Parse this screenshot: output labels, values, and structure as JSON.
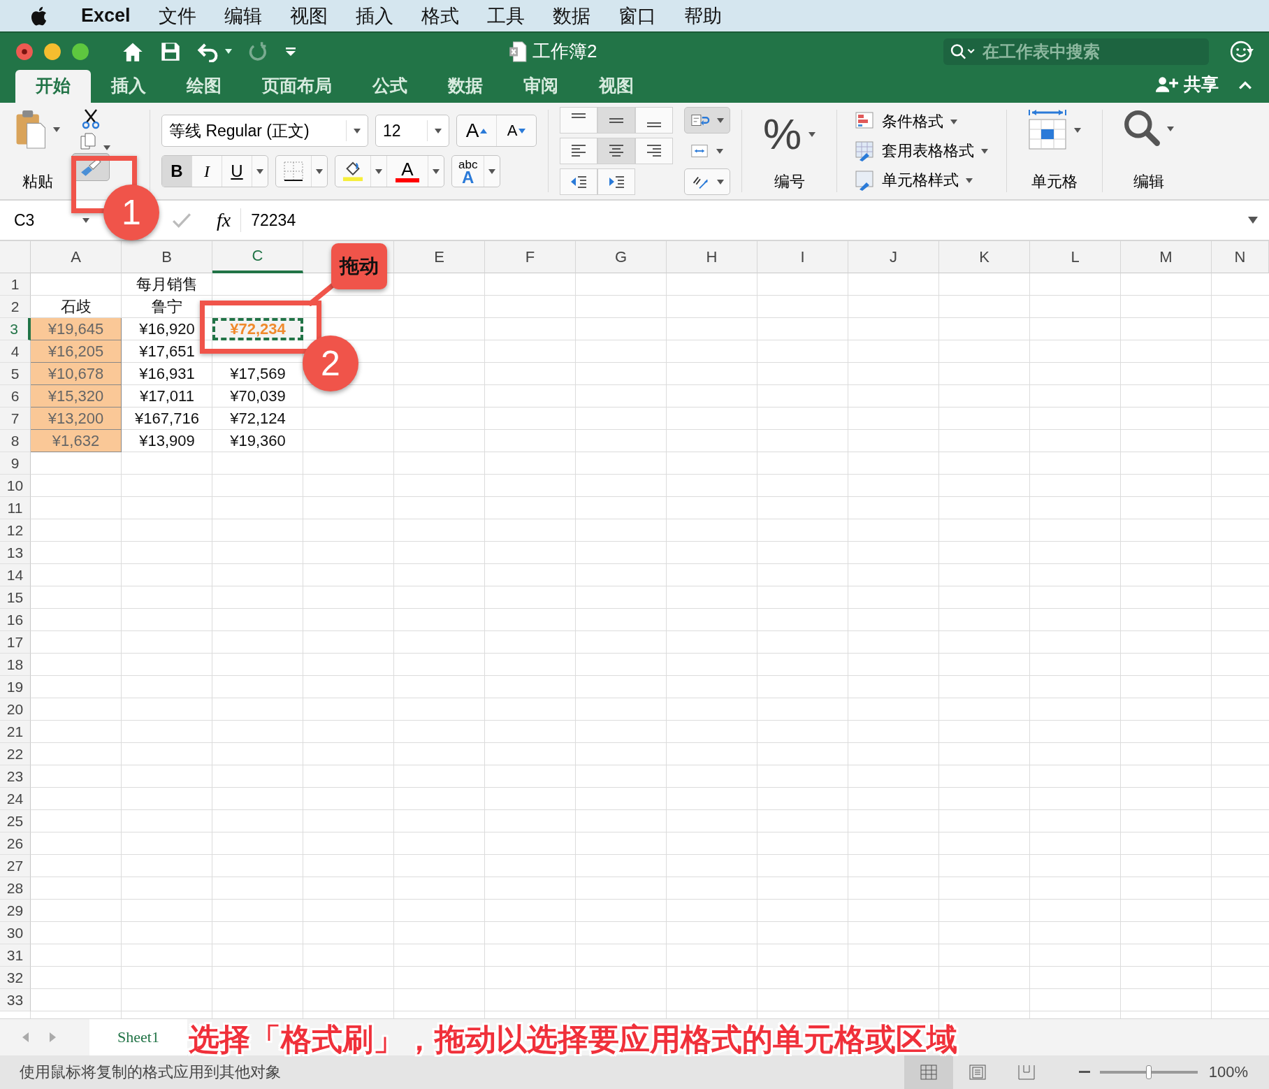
{
  "menu_bar": {
    "app": "Excel",
    "items": [
      "文件",
      "编辑",
      "视图",
      "插入",
      "格式",
      "工具",
      "数据",
      "窗口",
      "帮助"
    ]
  },
  "window": {
    "title": "工作簿2",
    "search": {
      "placeholder": "在工作表中搜索"
    },
    "redo_disabled": true
  },
  "tabs": [
    {
      "label": "开始",
      "selected": true
    },
    {
      "label": "插入",
      "selected": false
    },
    {
      "label": "绘图",
      "selected": false
    },
    {
      "label": "页面布局",
      "selected": false
    },
    {
      "label": "公式",
      "selected": false
    },
    {
      "label": "数据",
      "selected": false
    },
    {
      "label": "审阅",
      "selected": false
    },
    {
      "label": "视图",
      "selected": false
    }
  ],
  "share": "共享",
  "ribbon": {
    "paste": "粘贴",
    "font_name": "等线 Regular (正文)",
    "font_size": "12",
    "grow": "A",
    "shrink": "A",
    "bold": "B",
    "italic": "I",
    "underline": "U",
    "font_color": "A",
    "abc": "abc",
    "abc_letter": "A",
    "number_symbol": "%",
    "number": "编号",
    "styles": [
      "条件格式",
      "套用表格格式",
      "单元格样式"
    ],
    "cells": "单元格",
    "editing": "编辑"
  },
  "formula_bar": {
    "name_box": "C3",
    "fx": "fx",
    "formula": "72234"
  },
  "sheet": {
    "columns": [
      {
        "label": "A",
        "selected": false
      },
      {
        "label": "B",
        "selected": false
      },
      {
        "label": "C",
        "selected": true
      },
      {
        "selected": false
      },
      {
        "label": "E",
        "selected": false
      },
      {
        "label": "F",
        "selected": false
      },
      {
        "label": "G",
        "selected": false
      },
      {
        "label": "H",
        "selected": false
      },
      {
        "label": "I",
        "selected": false
      },
      {
        "label": "J",
        "selected": false
      },
      {
        "label": "K",
        "selected": false
      },
      {
        "label": "L",
        "selected": false
      },
      {
        "label": "M",
        "selected": false
      },
      {
        "label": "N",
        "selected": false
      }
    ],
    "rows": [
      {
        "header": "1",
        "selected": false,
        "cells": [
          null,
          {
            "text": "每月销售",
            "selected": false,
            "highlighted": false
          },
          null
        ]
      },
      {
        "header": "2",
        "selected": false,
        "cells": [
          {
            "text": "石歧",
            "selected": false,
            "highlighted": false
          },
          {
            "text": "鲁宁",
            "selected": false,
            "highlighted": false
          },
          null
        ]
      },
      {
        "header": "3",
        "selected": true,
        "cells": [
          {
            "text": "¥19,645",
            "selected": false,
            "highlighted": true
          },
          {
            "text": "¥16,920",
            "selected": false,
            "highlighted": false
          },
          {
            "text": "¥72,234",
            "selected": true,
            "highlighted": false
          }
        ]
      },
      {
        "header": "4",
        "selected": false,
        "cells": [
          {
            "text": "¥16,205",
            "selected": false,
            "highlighted": true
          },
          {
            "text": "¥17,651",
            "selected": false,
            "highlighted": false
          },
          null
        ]
      },
      {
        "header": "5",
        "selected": false,
        "cells": [
          {
            "text": "¥10,678",
            "selected": false,
            "highlighted": true
          },
          {
            "text": "¥16,931",
            "selected": false,
            "highlighted": false
          },
          {
            "text": "¥17,569",
            "selected": false,
            "highlighted": false
          }
        ]
      },
      {
        "header": "6",
        "selected": false,
        "cells": [
          {
            "text": "¥15,320",
            "selected": false,
            "highlighted": true
          },
          {
            "text": "¥17,011",
            "selected": false,
            "highlighted": false
          },
          {
            "text": "¥70,039",
            "selected": false,
            "highlighted": false
          }
        ]
      },
      {
        "header": "7",
        "selected": false,
        "cells": [
          {
            "text": "¥13,200",
            "selected": false,
            "highlighted": true
          },
          {
            "text": "¥167,716",
            "selected": false,
            "highlighted": false
          },
          {
            "text": "¥72,124",
            "selected": false,
            "highlighted": false
          }
        ]
      },
      {
        "header": "8",
        "selected": false,
        "cells": [
          {
            "text": "¥1,632",
            "selected": false,
            "highlighted": true
          },
          {
            "text": "¥13,909",
            "selected": false,
            "highlighted": false
          },
          {
            "text": "¥19,360",
            "selected": false,
            "highlighted": false
          }
        ]
      },
      {
        "header": "9",
        "selected": false
      },
      {
        "header": "10",
        "selected": false
      },
      {
        "header": "11",
        "selected": false
      },
      {
        "header": "12",
        "selected": false
      },
      {
        "header": "13",
        "selected": false
      },
      {
        "header": "14",
        "selected": false
      },
      {
        "header": "15",
        "selected": false
      },
      {
        "header": "16",
        "selected": false
      },
      {
        "header": "17",
        "selected": false
      },
      {
        "header": "18",
        "selected": false
      },
      {
        "header": "19",
        "selected": false
      },
      {
        "header": "20",
        "selected": false
      },
      {
        "header": "21",
        "selected": false
      },
      {
        "header": "22",
        "selected": false
      },
      {
        "header": "23",
        "selected": false
      },
      {
        "header": "24",
        "selected": false
      },
      {
        "header": "25",
        "selected": false
      },
      {
        "header": "26",
        "selected": false
      },
      {
        "header": "27",
        "selected": false
      },
      {
        "header": "28",
        "selected": false
      },
      {
        "header": "29",
        "selected": false
      },
      {
        "header": "30",
        "selected": false
      },
      {
        "header": "31",
        "selected": false
      },
      {
        "header": "32",
        "selected": false
      },
      {
        "header": "33",
        "selected": false
      }
    ]
  },
  "sheet_tabs": [
    {
      "label": "Sheet1",
      "selected": true
    }
  ],
  "status_bar": {
    "message": "使用鼠标将复制的格式应用到其他对象",
    "zoom": "100%",
    "zoom_slider": {
      "level": 0.5
    }
  },
  "annotations": [
    {
      "kind": "step",
      "label": "1"
    },
    {
      "kind": "step",
      "label": "2"
    },
    {
      "kind": "tag",
      "label": "拖动"
    }
  ],
  "caption": "选择「格式刷」，拖动以选择要应用格式的单元格或区域"
}
